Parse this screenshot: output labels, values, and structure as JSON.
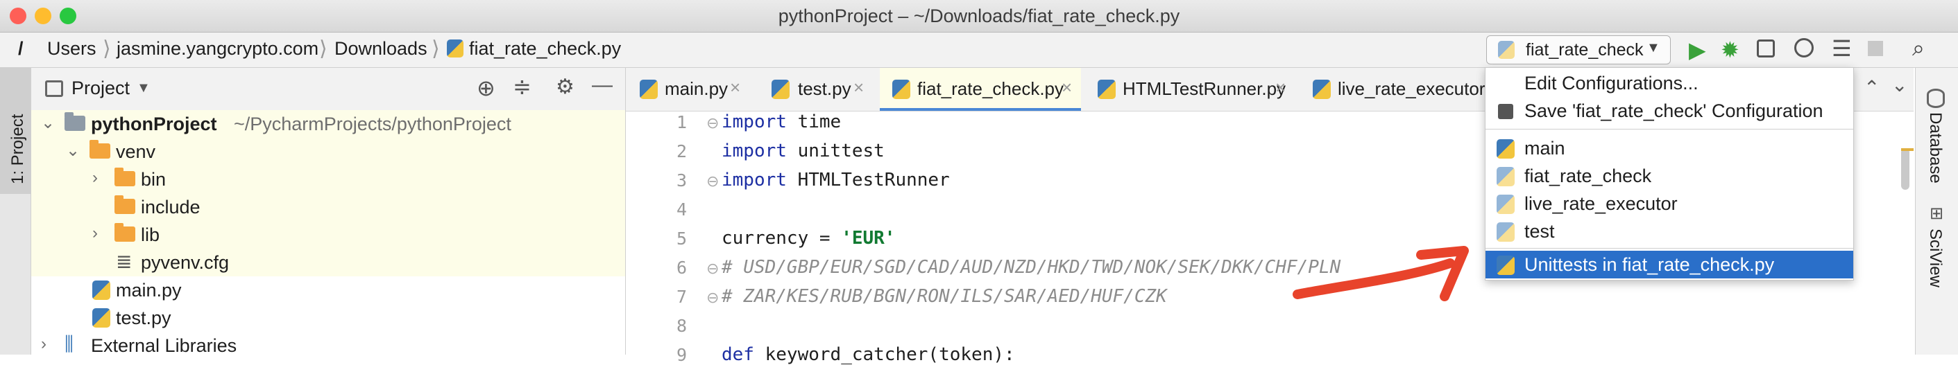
{
  "window": {
    "title": "pythonProject – ~/Downloads/fiat_rate_check.py"
  },
  "breadcrumb": [
    "/",
    "Users",
    "jasmine.yangcrypto.com",
    "Downloads",
    "fiat_rate_check.py"
  ],
  "run_config": {
    "selected": "fiat_rate_check"
  },
  "dropdown": {
    "actions": [
      "Edit Configurations...",
      "Save 'fiat_rate_check' Configuration"
    ],
    "configs": [
      "main",
      "fiat_rate_check",
      "live_rate_executor",
      "test"
    ],
    "selected_item": "Unittests in fiat_rate_check.py"
  },
  "left_strip": {
    "project_label": "1: Project"
  },
  "right_strip": {
    "database_label": "Database",
    "sciview_label": "SciView"
  },
  "project_panel": {
    "title": "Project",
    "tree": [
      {
        "label": "pythonProject",
        "path": "~/PycharmProjects/pythonProject"
      },
      {
        "label": "venv"
      },
      {
        "label": "bin"
      },
      {
        "label": "include"
      },
      {
        "label": "lib"
      },
      {
        "label": "pyvenv.cfg"
      },
      {
        "label": "main.py"
      },
      {
        "label": "test.py"
      },
      {
        "label": "External Libraries"
      }
    ]
  },
  "tabs": [
    "main.py",
    "test.py",
    "fiat_rate_check.py",
    "HTMLTestRunner.py",
    "live_rate_executor.py"
  ],
  "editor": {
    "line_numbers": [
      "1",
      "2",
      "3",
      "4",
      "5",
      "6",
      "7",
      "8",
      "9"
    ],
    "lines": [
      {
        "kw": "import",
        "rest": " time"
      },
      {
        "kw": "import",
        "rest": " unittest"
      },
      {
        "kw": "import",
        "rest": " HTMLTestRunner"
      },
      {
        "kw": "",
        "rest": ""
      },
      {
        "kw": "",
        "rest": "currency = ",
        "str": "'EUR'"
      },
      {
        "comment": "# USD/GBP/EUR/SGD/CAD/AUD/NZD/HKD/TWD/NOK/SEK/DKK/CHF/PLN"
      },
      {
        "comment": "# ZAR/KES/RUB/BGN/RON/ILS/SAR/AED/HUF/CZK"
      },
      {
        "kw": "",
        "rest": ""
      },
      {
        "kw": "def",
        "rest": " keyword_catcher(token):"
      }
    ]
  },
  "colors": {
    "accent": "#2a6fc9",
    "arrow": "#e8432b",
    "run_green": "#3aa13a"
  }
}
